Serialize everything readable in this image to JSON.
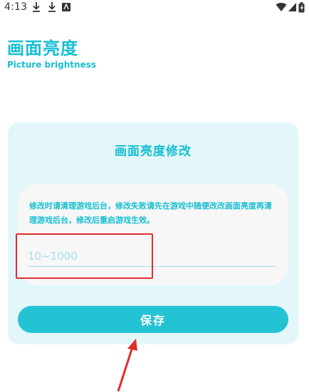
{
  "status_bar": {
    "time": "4:13",
    "left_icons": [
      "download-icon",
      "download-icon",
      "app-notification-icon"
    ],
    "right_icons": [
      "wifi-icon",
      "signal-icon",
      "battery-icon"
    ]
  },
  "header": {
    "title": "画面亮度",
    "subtitle": "Picture brightness"
  },
  "card": {
    "title": "画面亮度修改",
    "hint": "修改时请清理游戏后台，修改失败请先在游戏中随便改改画面亮度再清理游戏后台，修改后重启游戏生效。",
    "input_value": "",
    "input_placeholder": "10~1000",
    "save_label": "保存"
  },
  "annotations": {
    "highlight_color": "#e02d2d",
    "arrow_color": "#e02d2d"
  },
  "colors": {
    "accent": "#17bfd3",
    "button": "#24c3d3",
    "card_bg": "#e3f6f9",
    "inner_bg": "#f7f7f7"
  }
}
